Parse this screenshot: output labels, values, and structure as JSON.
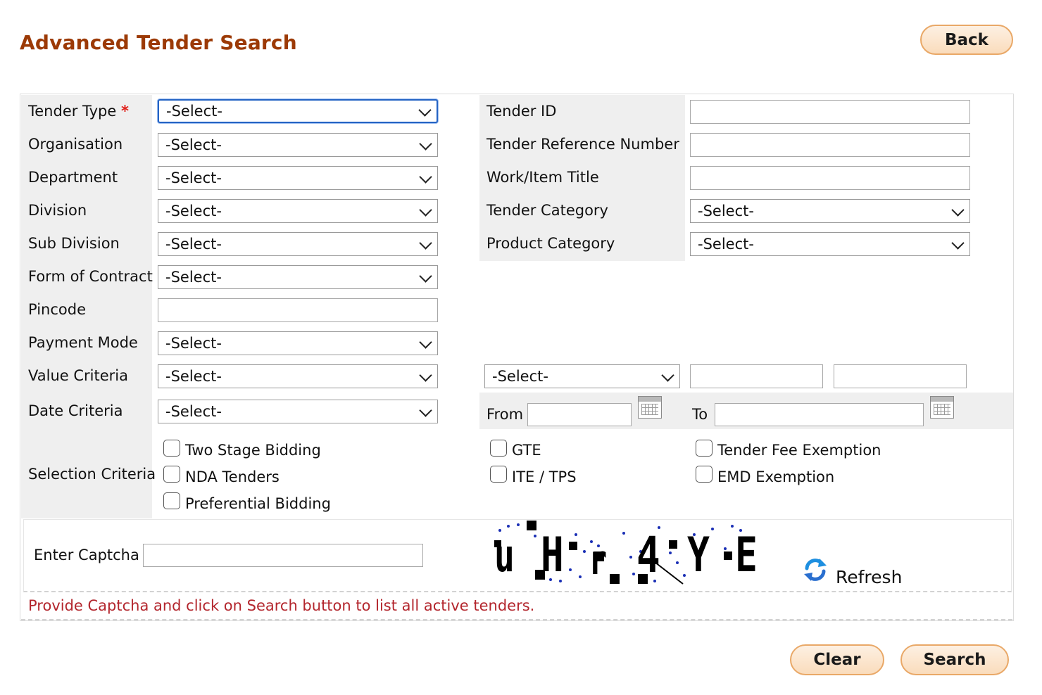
{
  "page": {
    "title": "Advanced Tender Search"
  },
  "buttons": {
    "back": "Back",
    "clear": "Clear",
    "search": "Search",
    "refresh": "Refresh"
  },
  "form": {
    "left_fields": [
      {
        "label": "Tender Type",
        "required_mark": "*",
        "type": "select",
        "value": "-Select-"
      },
      {
        "label": "Organisation",
        "type": "select",
        "value": "-Select-"
      },
      {
        "label": "Department",
        "type": "select",
        "value": "-Select-"
      },
      {
        "label": "Division",
        "type": "select",
        "value": "-Select-"
      },
      {
        "label": "Sub Division",
        "type": "select",
        "value": "-Select-"
      },
      {
        "label": "Form of Contract",
        "type": "select",
        "value": "-Select-"
      },
      {
        "label": "Pincode",
        "type": "text",
        "value": ""
      },
      {
        "label": "Payment Mode",
        "type": "select",
        "value": "-Select-"
      },
      {
        "label": "Value Criteria",
        "type": "select",
        "value": "-Select-"
      },
      {
        "label": "Date Criteria",
        "type": "select",
        "value": "-Select-"
      }
    ],
    "right_fields": [
      {
        "label": "Tender ID",
        "type": "text",
        "value": ""
      },
      {
        "label": "Tender Reference Number",
        "type": "text",
        "value": ""
      },
      {
        "label": "Work/Item Title",
        "type": "text",
        "value": ""
      },
      {
        "label": "Tender Category",
        "type": "select",
        "value": "-Select-"
      },
      {
        "label": "Product Category",
        "type": "select",
        "value": "-Select-"
      }
    ],
    "value_criteria_extra": {
      "operator_select": "-Select-",
      "from_value": "",
      "to_value": ""
    },
    "date_range": {
      "from_label": "From",
      "to_label": "To",
      "from_value": "",
      "to_value": ""
    },
    "selection_criteria": {
      "label": "Selection Criteria",
      "options": [
        {
          "label": "Two Stage Bidding",
          "checked": false
        },
        {
          "label": "NDA Tenders",
          "checked": false
        },
        {
          "label": "Preferential Bidding",
          "checked": false
        },
        {
          "label": "GTE",
          "checked": false
        },
        {
          "label": "ITE / TPS",
          "checked": false
        },
        {
          "label": "Tender Fee Exemption",
          "checked": false
        },
        {
          "label": "EMD Exemption",
          "checked": false
        }
      ]
    },
    "captcha": {
      "label": "Enter Captcha",
      "value": "",
      "image_text": "uHr4YE"
    }
  },
  "info_message": "Provide Captcha and click on Search button to list all active tenders.",
  "colors": {
    "title": "#9c3a06",
    "button_border": "#e9a867",
    "info_text": "#b3262d",
    "focus_border": "#2463c4",
    "required": "#e0201a"
  }
}
